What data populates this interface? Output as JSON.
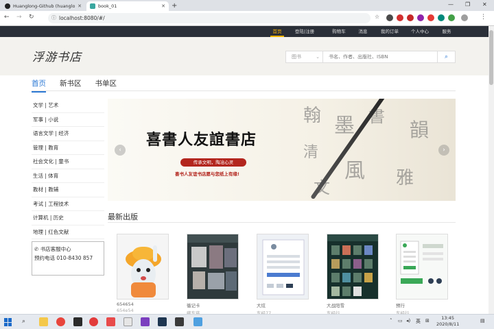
{
  "browser": {
    "tabs": [
      {
        "title": "Huanglong-Github (huanglon..."
      },
      {
        "title": "book_01"
      }
    ],
    "new_tab": "+",
    "url": "localhost:8080/#/",
    "window": {
      "minimize": "—",
      "restore": "❐",
      "close": "✕"
    }
  },
  "site_nav": {
    "items": [
      "首页",
      "登陆|注册",
      "购物车",
      "消息",
      "我的订单",
      "个人中心",
      "服务"
    ],
    "active_index": 0,
    "colors": {
      "active": "#ffb400",
      "bg": "#2a2f38"
    }
  },
  "header": {
    "logo": "浮游书店",
    "search": {
      "category": "图书",
      "placeholder": "书名、作者、出版社、ISBN"
    }
  },
  "tabs": {
    "items": [
      "首页",
      "新书区",
      "书单区"
    ],
    "active_index": 0
  },
  "categories": [
    "文学 | 艺术",
    "军事 | 小说",
    "语言文学 | 经济",
    "管理 | 教育",
    "社会文化 | 童书",
    "生活 | 体育",
    "教材 | 教辅",
    "考试 | 工程技术",
    "计算机 | 历史",
    "地理 | 红色文献"
  ],
  "service": {
    "title": "书店客服中心",
    "phone": "预约电话 010-8430 857"
  },
  "banner": {
    "title": "喜書人友誼書店",
    "pill": "传承文明，陶冶心灵",
    "subtitle": "喜书人友谊书店愿与您纸上有缘!",
    "prev": "‹",
    "next": "›"
  },
  "section": {
    "title": "最新出版"
  },
  "books": [
    {
      "title": "654654",
      "sub": "654e54"
    },
    {
      "title": "循记卡",
      "sub": "藏东蒋"
    },
    {
      "title": "大炫",
      "sub": "东经77"
    },
    {
      "title": "大战阳雪",
      "sub": "东经行"
    },
    {
      "title": "预行",
      "sub": "东经行"
    }
  ],
  "taskbar": {
    "ime": "英",
    "time": "13:45",
    "date": "2020/8/11"
  }
}
